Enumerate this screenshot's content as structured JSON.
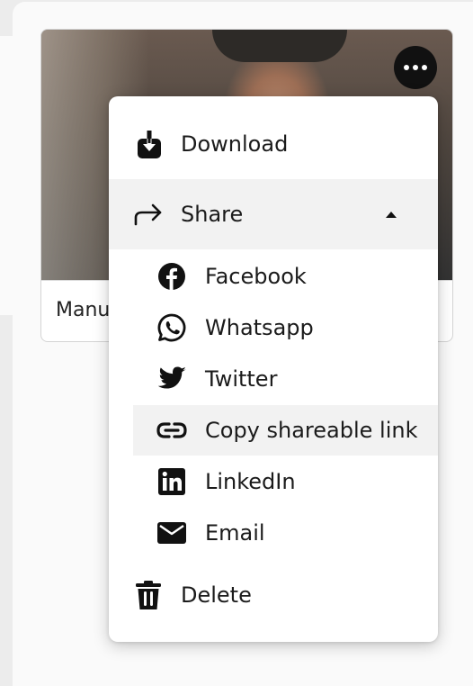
{
  "card": {
    "title": "Manu"
  },
  "menu": {
    "download_label": "Download",
    "share_label": "Share",
    "share_items": [
      {
        "label": "Facebook",
        "icon": "facebook-icon"
      },
      {
        "label": "Whatsapp",
        "icon": "whatsapp-icon"
      },
      {
        "label": "Twitter",
        "icon": "twitter-icon"
      },
      {
        "label": "Copy shareable link",
        "icon": "link-icon"
      },
      {
        "label": "LinkedIn",
        "icon": "linkedin-icon"
      },
      {
        "label": "Email",
        "icon": "email-icon"
      }
    ],
    "delete_label": "Delete"
  },
  "colors": {
    "highlight": "#f2f2f2",
    "icon": "#111111",
    "text": "#1b1b1b"
  }
}
